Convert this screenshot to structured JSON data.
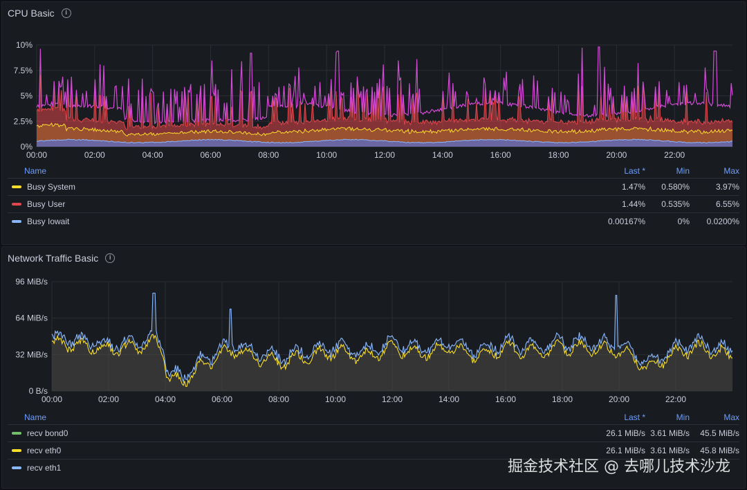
{
  "cpu_panel": {
    "title": "CPU Basic",
    "info_icon": "info-icon",
    "legend_headers": {
      "name": "Name",
      "last": "Last *",
      "min": "Min",
      "max": "Max"
    },
    "series": [
      {
        "name": "Busy System",
        "color": "#fade2a",
        "last": "1.47%",
        "min": "0.580%",
        "max": "3.97%"
      },
      {
        "name": "Busy User",
        "color": "#e0464b",
        "last": "1.44%",
        "min": "0.535%",
        "max": "6.55%"
      },
      {
        "name": "Busy Iowait",
        "color": "#8ab8ff",
        "last": "0.00167%",
        "min": "0%",
        "max": "0.0200%"
      }
    ]
  },
  "net_panel": {
    "title": "Network Traffic Basic",
    "info_icon": "info-icon",
    "legend_headers": {
      "name": "Name",
      "last": "Last *",
      "min": "Min",
      "max": "Max"
    },
    "series": [
      {
        "name": "recv bond0",
        "color": "#73bf69",
        "last": "26.1 MiB/s",
        "min": "3.61 MiB/s",
        "max": "45.5 MiB/s"
      },
      {
        "name": "recv eth0",
        "color": "#fade2a",
        "last": "26.1 MiB/s",
        "min": "3.61 MiB/s",
        "max": "45.8 MiB/s"
      },
      {
        "name": "recv eth1",
        "color": "#8ab8ff",
        "last": "",
        "min": "",
        "max": ""
      }
    ]
  },
  "watermark": "掘金技术社区 @ 去哪儿技术沙龙",
  "chart_data": [
    {
      "type": "line",
      "title": "CPU Basic",
      "y_ticks": [
        "0%",
        "2.5%",
        "5%",
        "7.5%",
        "10%"
      ],
      "ylim": [
        0,
        10
      ],
      "x_ticks": [
        "00:00",
        "02:00",
        "04:00",
        "06:00",
        "08:00",
        "10:00",
        "12:00",
        "14:00",
        "16:00",
        "18:00",
        "20:00",
        "22:00"
      ],
      "xlim": [
        0,
        24
      ],
      "grid": true,
      "legend_placement": "bottom",
      "series": [
        {
          "name": "Busy System",
          "color": "#fade2a",
          "min": 0.58,
          "max": 3.97,
          "last": 1.47
        },
        {
          "name": "Busy User",
          "color": "#e0464b",
          "min": 0.535,
          "max": 6.55,
          "last": 1.44
        },
        {
          "name": "Busy Iowait",
          "color": "#8ab8ff",
          "min": 0,
          "max": 0.02,
          "last": 0.00167
        }
      ],
      "peaks": [
        {
          "x": 7.4,
          "y": 9.2
        },
        {
          "x": 10.4,
          "y": 9.4
        },
        {
          "x": 19.4,
          "y": 9.8
        },
        {
          "x": 23.4,
          "y": 9.4
        }
      ]
    },
    {
      "type": "area",
      "title": "Network Traffic Basic",
      "y_ticks": [
        "0 B/s",
        "32 MiB/s",
        "64 MiB/s",
        "96 MiB/s"
      ],
      "ylim": [
        0,
        96
      ],
      "x_ticks": [
        "00:00",
        "02:00",
        "04:00",
        "06:00",
        "08:00",
        "10:00",
        "12:00",
        "14:00",
        "16:00",
        "18:00",
        "20:00",
        "22:00"
      ],
      "xlim": [
        0,
        24
      ],
      "grid": true,
      "legend_placement": "bottom",
      "series": [
        {
          "name": "recv bond0",
          "color": "#73bf69",
          "min": 3.61,
          "max": 45.5,
          "last": 26.1
        },
        {
          "name": "recv eth0",
          "color": "#fade2a",
          "min": 3.61,
          "max": 45.8,
          "last": 26.1
        },
        {
          "name": "recv eth1",
          "color": "#8ab8ff"
        }
      ],
      "profile": [
        {
          "x": 0,
          "y": 42
        },
        {
          "x": 1,
          "y": 40
        },
        {
          "x": 2,
          "y": 37
        },
        {
          "x": 3,
          "y": 38
        },
        {
          "x": 3.6,
          "y": 43
        },
        {
          "x": 3.9,
          "y": 36
        },
        {
          "x": 4.1,
          "y": 12
        },
        {
          "x": 4.6,
          "y": 8
        },
        {
          "x": 5.2,
          "y": 20
        },
        {
          "x": 6,
          "y": 33
        },
        {
          "x": 6.5,
          "y": 36
        },
        {
          "x": 7.2,
          "y": 30
        },
        {
          "x": 8,
          "y": 25
        },
        {
          "x": 9,
          "y": 30
        },
        {
          "x": 10,
          "y": 35
        },
        {
          "x": 11,
          "y": 30
        },
        {
          "x": 12,
          "y": 38
        },
        {
          "x": 13,
          "y": 33
        },
        {
          "x": 14,
          "y": 38
        },
        {
          "x": 15,
          "y": 30
        },
        {
          "x": 16,
          "y": 38
        },
        {
          "x": 17,
          "y": 34
        },
        {
          "x": 18,
          "y": 38
        },
        {
          "x": 19,
          "y": 38
        },
        {
          "x": 20,
          "y": 35
        },
        {
          "x": 20.5,
          "y": 30
        },
        {
          "x": 21,
          "y": 20
        },
        {
          "x": 22,
          "y": 34
        },
        {
          "x": 23,
          "y": 38
        },
        {
          "x": 24,
          "y": 30
        }
      ],
      "peaks": [
        {
          "x": 3.6,
          "y": 86
        },
        {
          "x": 6.3,
          "y": 72
        },
        {
          "x": 19.9,
          "y": 84
        }
      ]
    }
  ]
}
